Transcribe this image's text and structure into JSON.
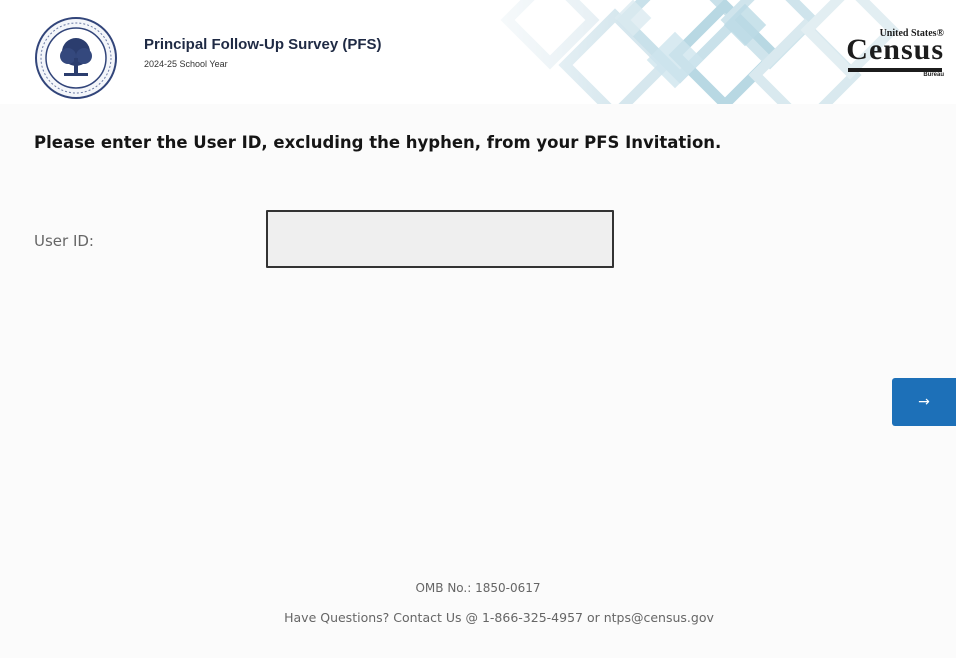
{
  "header": {
    "title": "Principal Follow-Up Survey (PFS)",
    "subtitle": "2024-25 School Year",
    "census_logo": {
      "top_text": "United States®",
      "main_text": "Census",
      "bottom_text": "Bureau"
    },
    "seal_icon": "department-of-education-seal-icon"
  },
  "form": {
    "instruction": "Please enter the User ID, excluding the hyphen, from your PFS Invitation.",
    "userid_label": "User ID:",
    "userid_value": "",
    "userid_placeholder": "",
    "next_label": "→"
  },
  "footer": {
    "omb": "OMB No.: 1850-0617",
    "contact": "Have Questions? Contact Us @ 1-866-325-4957 or ntps@census.gov"
  },
  "colors": {
    "accent_button": "#1d70b8",
    "input_background": "#efefef",
    "title_text": "#1f2a44"
  }
}
